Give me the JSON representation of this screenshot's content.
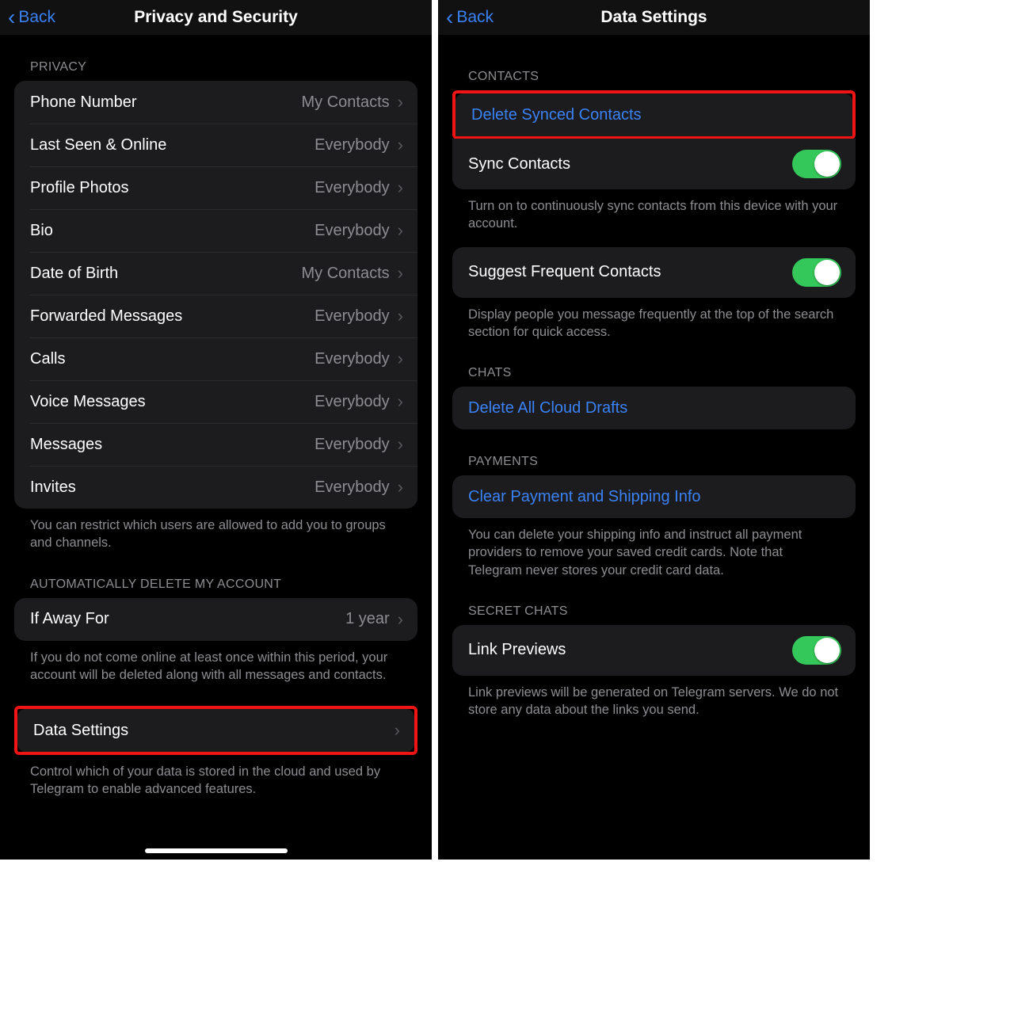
{
  "left": {
    "back": "Back",
    "title": "Privacy and Security",
    "privacy_header": "PRIVACY",
    "privacy_rows": [
      {
        "label": "Phone Number",
        "value": "My Contacts"
      },
      {
        "label": "Last Seen & Online",
        "value": "Everybody"
      },
      {
        "label": "Profile Photos",
        "value": "Everybody"
      },
      {
        "label": "Bio",
        "value": "Everybody"
      },
      {
        "label": "Date of Birth",
        "value": "My Contacts"
      },
      {
        "label": "Forwarded Messages",
        "value": "Everybody"
      },
      {
        "label": "Calls",
        "value": "Everybody"
      },
      {
        "label": "Voice Messages",
        "value": "Everybody"
      },
      {
        "label": "Messages",
        "value": "Everybody"
      },
      {
        "label": "Invites",
        "value": "Everybody"
      }
    ],
    "privacy_footer": "You can restrict which users are allowed to add you to groups and channels.",
    "auto_delete_header": "AUTOMATICALLY DELETE MY ACCOUNT",
    "if_away_label": "If Away For",
    "if_away_value": "1 year",
    "auto_delete_footer": "If you do not come online at least once within this period, your account will be deleted along with all messages and contacts.",
    "data_settings_label": "Data Settings",
    "data_settings_footer": "Control which of your data is stored in the cloud and used by Telegram to enable advanced features."
  },
  "right": {
    "back": "Back",
    "title": "Data Settings",
    "contacts_header": "CONTACTS",
    "delete_synced_label": "Delete Synced Contacts",
    "sync_contacts_label": "Sync Contacts",
    "sync_contacts_footer": "Turn on to continuously sync contacts from this device with your account.",
    "suggest_label": "Suggest Frequent Contacts",
    "suggest_footer": "Display people you message frequently at the top of the search section for quick access.",
    "chats_header": "CHATS",
    "delete_drafts_label": "Delete All Cloud Drafts",
    "payments_header": "PAYMENTS",
    "clear_payment_label": "Clear Payment and Shipping Info",
    "payments_footer": "You can delete your shipping info and instruct all payment providers to remove your saved credit cards. Note that Telegram never stores your credit card data.",
    "secret_header": "SECRET CHATS",
    "link_previews_label": "Link Previews",
    "link_previews_footer": "Link previews will be generated on Telegram servers. We do not store any data about the links you send."
  }
}
